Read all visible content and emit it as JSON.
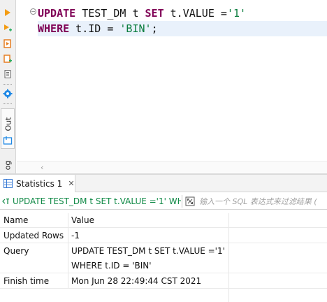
{
  "toolbar": {
    "buttons": [
      "execute-statement-icon",
      "execute-script-icon",
      "execute-in-new-tab-icon",
      "explain-plan-icon",
      "load-script-icon",
      "settings-gear-icon"
    ],
    "out_tab_label": "Out",
    "log_tab_label": "og"
  },
  "editor": {
    "line1": {
      "kw1": "UPDATE",
      "t1": " TEST_DM t ",
      "kw2": "SET",
      "t2": " t.VALUE =",
      "s1": "'1'"
    },
    "line2": {
      "kw1": "WHERE",
      "t1": " t.ID = ",
      "s1": "'BIN'",
      "t2": ";"
    }
  },
  "panel": {
    "tab_label": "Statistics 1",
    "tab_close": "✕",
    "query_preview": "UPDATE TEST_DM t SET t.VALUE ='1' WH",
    "filter_placeholder": "输入一个 SQL 表达式来过滤结果 (",
    "columns": {
      "name": "Name",
      "value": "Value"
    },
    "rows": {
      "updated_rows": {
        "name": "Updated Rows",
        "value": "-1"
      },
      "query": {
        "name": "Query",
        "line1": "UPDATE TEST_DM t SET t.VALUE ='1'",
        "line2": "WHERE t.ID = 'BIN'"
      },
      "finish_time": {
        "name": "Finish time",
        "value": "Mon Jun 28 22:49:44 CST 2021"
      }
    }
  },
  "colors": {
    "keyword": "#7f0055",
    "string": "#0b7d3e",
    "current_line": "#e9f1fb",
    "run_arrow": "#f39c12",
    "gear": "#1e88e5"
  }
}
